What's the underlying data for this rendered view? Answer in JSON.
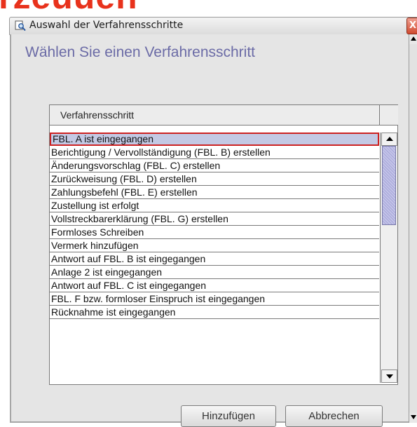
{
  "background_text": "rzeuuen",
  "window": {
    "title": "Auswahl der Verfahrensschritte",
    "close_label": "X",
    "heading": "Wählen Sie einen Verfahrensschritt"
  },
  "table": {
    "column_header": "Verfahrensschritt",
    "selected_index": 0,
    "rows": [
      "FBL. A ist eingegangen",
      "Berichtigung / Vervollständigung (FBL. B) erstellen",
      "Änderungsvorschlag (FBL. C) erstellen",
      "Zurückweisung (FBL. D) erstellen",
      "Zahlungsbefehl (FBL. E) erstellen",
      "Zustellung ist erfolgt",
      "Vollstreckbarerklärung (FBL. G) erstellen",
      "Formloses Schreiben",
      "Vermerk hinzufügen",
      "Antwort auf FBL. B ist eingegangen",
      "Anlage 2 ist eingegangen",
      "Antwort auf FBL. C ist eingegangen",
      "FBL. F bzw. formloser Einspruch ist eingegangen",
      "Rücknahme ist eingegangen"
    ]
  },
  "buttons": {
    "add": "Hinzufügen",
    "cancel": "Abbrechen"
  },
  "icons": {
    "window_icon": "magnifier-document-icon",
    "scroll_up": "arrow-up-icon",
    "scroll_down": "arrow-down-icon"
  },
  "colors": {
    "heading": "#6b6ba6",
    "selection_bg": "#c3c9e4",
    "selection_border": "#cc2222",
    "background_text": "#e8321c"
  }
}
